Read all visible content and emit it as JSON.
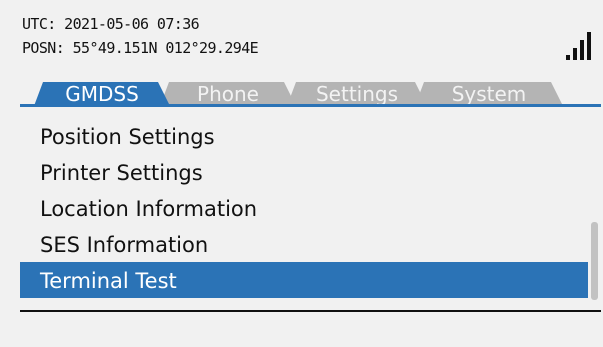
{
  "status": {
    "utc_label": "UTC:",
    "utc_value": "2021-05-06 07:36",
    "posn_label": "POSN:",
    "posn_value": "55°49.151N 012°29.294E",
    "signal_icon": "signal-strength-icon"
  },
  "tabs": [
    {
      "label": "GMDSS",
      "active": true
    },
    {
      "label": "Phone",
      "active": false
    },
    {
      "label": "Settings",
      "active": false
    },
    {
      "label": "System",
      "active": false
    }
  ],
  "menu": {
    "items": [
      {
        "label": "Position Settings"
      },
      {
        "label": "Printer Settings"
      },
      {
        "label": "Location Information"
      },
      {
        "label": "SES Information"
      },
      {
        "label": "Terminal Test"
      }
    ],
    "selected_index": 4
  },
  "colors": {
    "accent": "#2b73b6",
    "inactive_tab": "#b4b4b4",
    "background": "#f1f1f1"
  }
}
